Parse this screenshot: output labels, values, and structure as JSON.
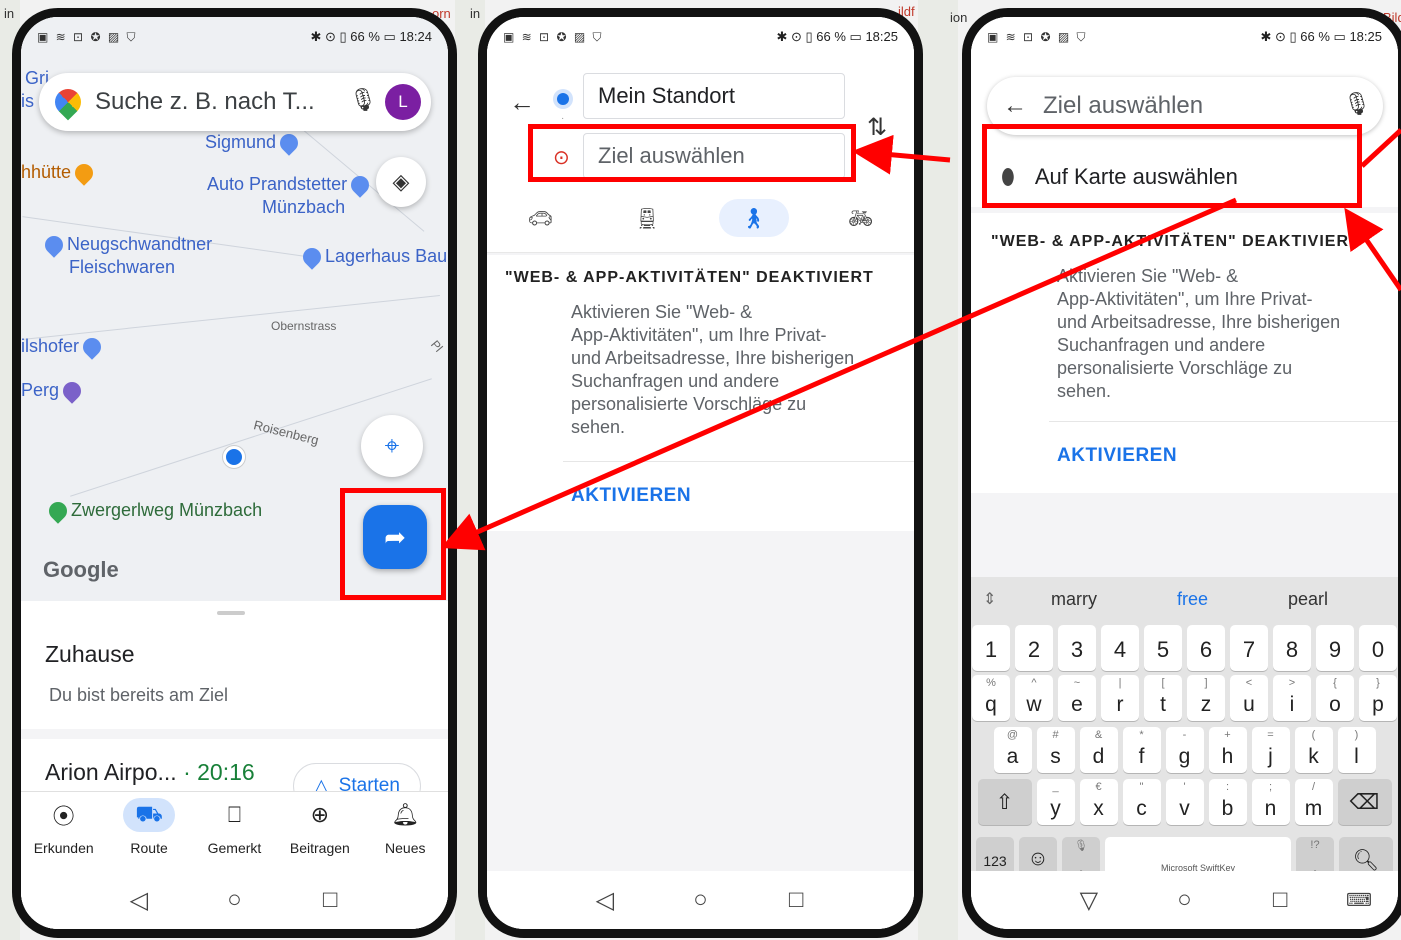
{
  "background": {
    "left_fragment": "in",
    "mid_left_fragment": "in",
    "mid_left_red": "orn",
    "mid_right_fragment": "ion",
    "mid_right_red": "ildf",
    "right_red": "Bild"
  },
  "status_bar": {
    "icons_left": "▣ ≋ ⊡ ✪ ▨ ⛉",
    "indicators": "✱ ⊙ ▯",
    "battery": "66 %",
    "time_1": "18:24",
    "time_2": "18:25",
    "time_3": "18:25"
  },
  "phone1": {
    "search_placeholder": "Suche z. B. nach T...",
    "avatar_letter": "L",
    "top_partial": "Gri...",
    "is_partial": "is",
    "map_labels": {
      "sigmund": "Sigmund",
      "huette": "hhütte",
      "auto": "Auto Prandstetter",
      "muenzbach": "Münzbach",
      "neug1": "Neugschwandtner",
      "neug2": "Fleischwaren",
      "lagerhaus": "Lagerhaus Bau",
      "obernstrass": "Obernstrass",
      "pl": "Pl",
      "ilshofer": "ilshofer",
      "perg": "Perg",
      "roisenberg": "Roisenberg",
      "zwerg": "Zwergerlweg Münzbach",
      "google": "Google"
    },
    "home_title": "Zuhause",
    "home_sub": "Du bist bereits am Ziel",
    "airport_title": "Arion Airpo...",
    "airport_time": "· 20:16",
    "start_label": "Starten",
    "tabs": [
      {
        "icon": "⦿",
        "label": "Erkunden"
      },
      {
        "icon": "⛟",
        "label": "Route"
      },
      {
        "icon": "⎕",
        "label": "Gemerkt"
      },
      {
        "icon": "⊕",
        "label": "Beitragen"
      },
      {
        "icon": "🔔︎",
        "label": "Neues"
      }
    ]
  },
  "phone2": {
    "origin": "Mein Standort",
    "destination": "Ziel auswählen",
    "modes": [
      "🚗︎",
      "🚆︎",
      "🚶︎",
      "🚲︎"
    ],
    "notice_title": "\"WEB- & APP-AKTIVITÄTEN\" DEAKTIVIERT",
    "notice_lines": [
      "Aktivieren Sie \"Web- &",
      "App-Aktivitäten\", um Ihre Privat-",
      "und Arbeitsadresse, Ihre bisherigen",
      "Suchanfragen und andere",
      "personalisierte Vorschläge zu",
      "sehen."
    ],
    "activate": "AKTIVIEREN"
  },
  "phone3": {
    "search_placeholder": "Ziel auswählen",
    "pick_on_map": "Auf Karte auswählen",
    "notice_title": "\"WEB- & APP-AKTIVITÄTEN\" DEAKTIVIERT",
    "notice_lines": [
      "Aktivieren Sie \"Web- &",
      "App-Aktivitäten\", um Ihre Privat-",
      "und Arbeitsadresse, Ihre bisherigen",
      "Suchanfragen und andere",
      "personalisierte Vorschläge zu",
      "sehen."
    ],
    "activate": "AKTIVIEREN",
    "suggestions": [
      "marry",
      "free",
      "pearl"
    ],
    "numbers": [
      "1",
      "2",
      "3",
      "4",
      "5",
      "6",
      "7",
      "8",
      "9",
      "0"
    ],
    "row1": [
      [
        "q",
        "%"
      ],
      [
        "w",
        "^"
      ],
      [
        "e",
        "~"
      ],
      [
        "r",
        "|"
      ],
      [
        "t",
        "["
      ],
      [
        "z",
        "]"
      ],
      [
        "u",
        "<"
      ],
      [
        "i",
        ">"
      ],
      [
        "o",
        "{"
      ],
      [
        "p",
        "}"
      ]
    ],
    "row2": [
      [
        "a",
        "@"
      ],
      [
        "s",
        "#"
      ],
      [
        "d",
        "&"
      ],
      [
        "f",
        "*"
      ],
      [
        "g",
        "-"
      ],
      [
        "h",
        "+"
      ],
      [
        "j",
        "="
      ],
      [
        "k",
        "("
      ],
      [
        "l",
        ")"
      ]
    ],
    "row3": [
      [
        "y",
        "_"
      ],
      [
        "x",
        "€"
      ],
      [
        "c",
        "\""
      ],
      [
        "v",
        "'"
      ],
      [
        "b",
        ":"
      ],
      [
        "n",
        ";"
      ],
      [
        "m",
        "/"
      ]
    ],
    "key_123": "123",
    "space_label": "Microsoft SwiftKey",
    "comma": ",",
    "period": "."
  },
  "nav_buttons": [
    "◁",
    "○",
    "□"
  ],
  "nav_buttons_3": [
    "▽",
    "○",
    "□"
  ],
  "colors": {
    "annotation_red": "#ff0000",
    "google_blue": "#1a73e8"
  }
}
